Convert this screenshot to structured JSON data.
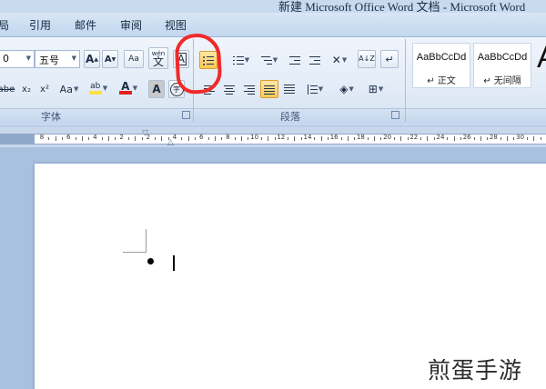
{
  "window": {
    "title": "新建 Microsoft Office Word 文档 - Microsoft Word"
  },
  "tabs": [
    {
      "label": "局"
    },
    {
      "label": "引用"
    },
    {
      "label": "邮件"
    },
    {
      "label": "审阅"
    },
    {
      "label": "视图"
    }
  ],
  "font_group": {
    "label": "字体",
    "font_name": "0",
    "font_size": "五号",
    "grow_font": "A",
    "shrink_font": "A",
    "clear_format": "Aa",
    "phonetic": "wén",
    "phonetic_char": "文",
    "char_border": "A",
    "strikethrough": "abe",
    "subscript": "x₂",
    "superscript": "x²",
    "change_case": "Aa",
    "highlight": "ab",
    "font_color": "A",
    "char_shading": "A",
    "enclose": "字"
  },
  "paragraph_group": {
    "label": "段落",
    "sort": "A↓Z"
  },
  "styles_group": {
    "items": [
      {
        "sample": "AaBbCcDd",
        "name": "↵ 正文"
      },
      {
        "sample": "AaBbCcDd",
        "name": "↵ 无间隔"
      }
    ],
    "more_sample": "A"
  },
  "ruler": {
    "labels": [
      "8",
      "6",
      "4",
      "2",
      "2",
      "4",
      "6",
      "8",
      "10",
      "12",
      "14",
      "16",
      "18",
      "20",
      "22",
      "24",
      "26",
      "28",
      "30"
    ]
  },
  "watermark": "煎蛋手游",
  "colors": {
    "annotation": "#f12a2a",
    "highlight": "#ffe13b",
    "font_color": "#e02020",
    "active_button": "#ffc95a"
  }
}
